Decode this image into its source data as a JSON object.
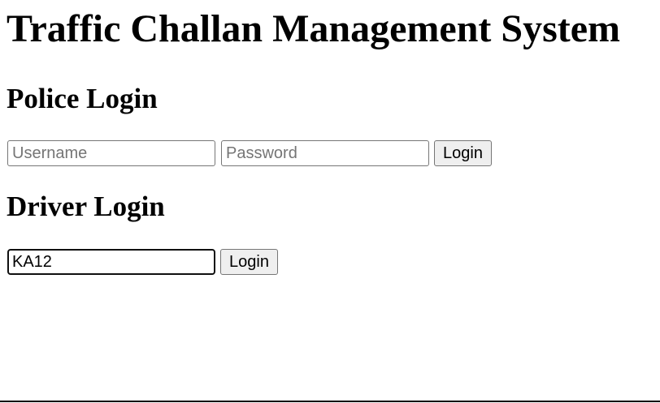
{
  "page": {
    "title": "Traffic Challan Management System"
  },
  "police_login": {
    "heading": "Police Login",
    "username_placeholder": "Username",
    "username_value": "",
    "password_placeholder": "Password",
    "password_value": "",
    "login_label": "Login"
  },
  "driver_login": {
    "heading": "Driver Login",
    "vehicle_value": "KA12",
    "vehicle_placeholder": "",
    "login_label": "Login"
  }
}
